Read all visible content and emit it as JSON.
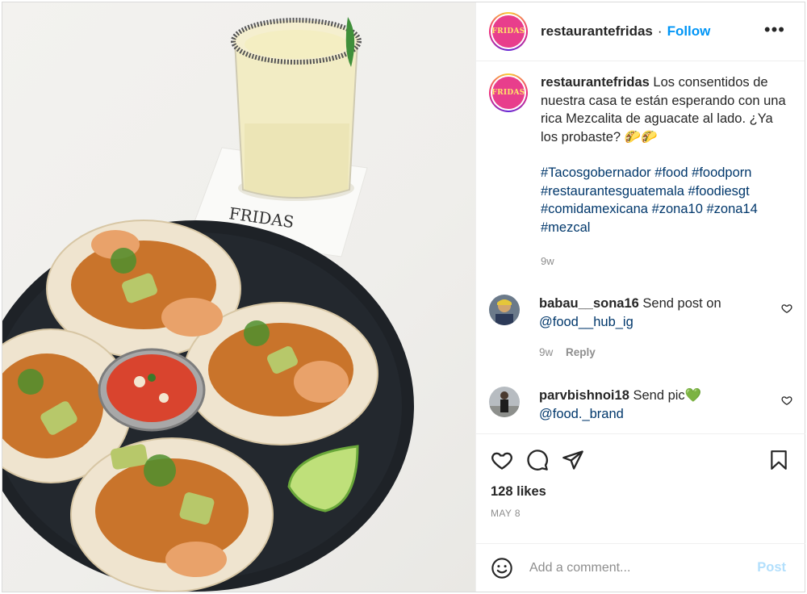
{
  "post": {
    "username": "restaurantefridas",
    "follow_label": "Follow",
    "separator": "·",
    "more_label": "•••",
    "avatar_text": "FRIDAS",
    "photo_coaster_text": "FRIDAS"
  },
  "caption": {
    "username": "restaurantefridas",
    "text": "Los consentidos de nuestra casa te están esperando con una rica Mezcalita de aguacate al lado. ¿Ya los probaste? 🌮🌮",
    "hashtags": "#Tacosgobernador #food #foodporn #restaurantesguatemala #foodiesgt #comidamexicana #zona10 #zona14 #mezcal",
    "time": "9w"
  },
  "comments": [
    {
      "username": "babau__sona16",
      "text": "Send post on",
      "mention": "@food__hub_ig",
      "time": "9w",
      "reply_label": "Reply"
    },
    {
      "username": "parvbishnoi18",
      "text": "Send pic💚",
      "mention": "@food._brand"
    }
  ],
  "actions": {
    "likes": "128 likes",
    "date": "MAY 8"
  },
  "add_comment": {
    "placeholder": "Add a comment...",
    "post_label": "Post"
  },
  "colors": {
    "link": "#0095f6",
    "hashtag": "#00376b",
    "muted": "#8e8e8e",
    "post_disabled": "#b2dffc",
    "brand_pink": "#e83e8c"
  }
}
